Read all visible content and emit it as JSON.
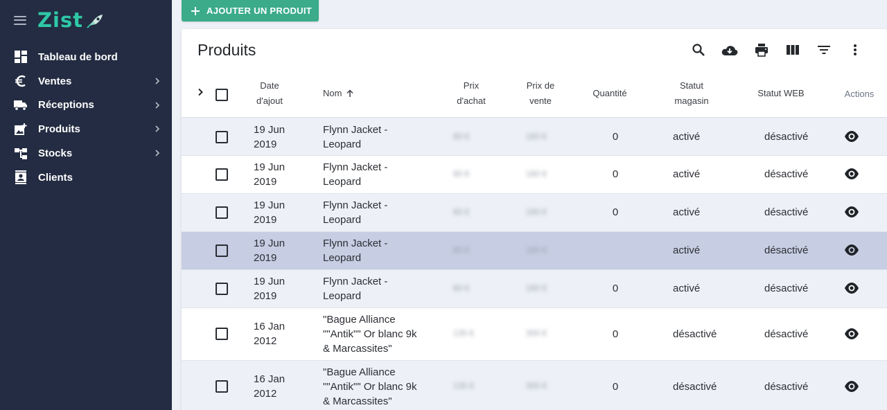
{
  "sidebar": {
    "logo": "Zist",
    "items": [
      {
        "label": "Tableau de bord",
        "icon": "dashboard-icon",
        "has_submenu": false
      },
      {
        "label": "Ventes",
        "icon": "euro-icon",
        "has_submenu": true
      },
      {
        "label": "Réceptions",
        "icon": "truck-icon",
        "has_submenu": true
      },
      {
        "label": "Produits",
        "icon": "add-photo-icon",
        "has_submenu": true
      },
      {
        "label": "Stocks",
        "icon": "stock-tree-icon",
        "has_submenu": true
      },
      {
        "label": "Clients",
        "icon": "contacts-icon",
        "has_submenu": false
      }
    ]
  },
  "toolbar": {
    "add_label": "AJOUTER UN PRODUIT"
  },
  "card": {
    "title": "Produits",
    "tools": [
      "search-icon",
      "download-icon",
      "print-icon",
      "columns-icon",
      "filter-icon",
      "more-vert-icon"
    ]
  },
  "table": {
    "headers": {
      "date_1": "Date",
      "date_2": "d'ajout",
      "name": "Nom",
      "buy_1": "Prix",
      "buy_2": "d'achat",
      "sell_1": "Prix de",
      "sell_2": "vente",
      "qty": "Quantité",
      "shop_1": "Statut",
      "shop_2": "magasin",
      "web": "Statut WEB",
      "actions": "Actions"
    },
    "sort": {
      "column": "Nom",
      "direction": "asc"
    },
    "rows": [
      {
        "date_1": "19 Jun",
        "date_2": "2019",
        "name_1": "Flynn Jacket -",
        "name_2": "Leopard",
        "name_3": "",
        "buy": "80 €",
        "sell": "160 €",
        "qty": "0",
        "shop": "activé",
        "web": "désactivé"
      },
      {
        "date_1": "19 Jun",
        "date_2": "2019",
        "name_1": "Flynn Jacket -",
        "name_2": "Leopard",
        "name_3": "",
        "buy": "80 €",
        "sell": "160 €",
        "qty": "0",
        "shop": "activé",
        "web": "désactivé"
      },
      {
        "date_1": "19 Jun",
        "date_2": "2019",
        "name_1": "Flynn Jacket -",
        "name_2": "Leopard",
        "name_3": "",
        "buy": "80 €",
        "sell": "160 €",
        "qty": "0",
        "shop": "activé",
        "web": "désactivé"
      },
      {
        "date_1": "19 Jun",
        "date_2": "2019",
        "name_1": "Flynn Jacket -",
        "name_2": "Leopard",
        "name_3": "",
        "buy": "80 €",
        "sell": "160 €",
        "qty": "",
        "shop": "activé",
        "web": "désactivé"
      },
      {
        "date_1": "19 Jun",
        "date_2": "2019",
        "name_1": "Flynn Jacket -",
        "name_2": "Leopard",
        "name_3": "",
        "buy": "80 €",
        "sell": "160 €",
        "qty": "0",
        "shop": "activé",
        "web": "désactivé"
      },
      {
        "date_1": "16 Jan",
        "date_2": "2012",
        "name_1": "\"Bague Alliance",
        "name_2": "\"\"Antik\"\" Or blanc 9k",
        "name_3": "& Marcassites\"",
        "buy": "135 €",
        "sell": "300 €",
        "qty": "0",
        "shop": "désactivé",
        "web": "désactivé"
      },
      {
        "date_1": "16 Jan",
        "date_2": "2012",
        "name_1": "\"Bague Alliance",
        "name_2": "\"\"Antik\"\" Or blanc 9k",
        "name_3": "& Marcassites\"",
        "buy": "135 €",
        "sell": "300 €",
        "qty": "0",
        "shop": "désactivé",
        "web": "désactivé"
      }
    ]
  }
}
